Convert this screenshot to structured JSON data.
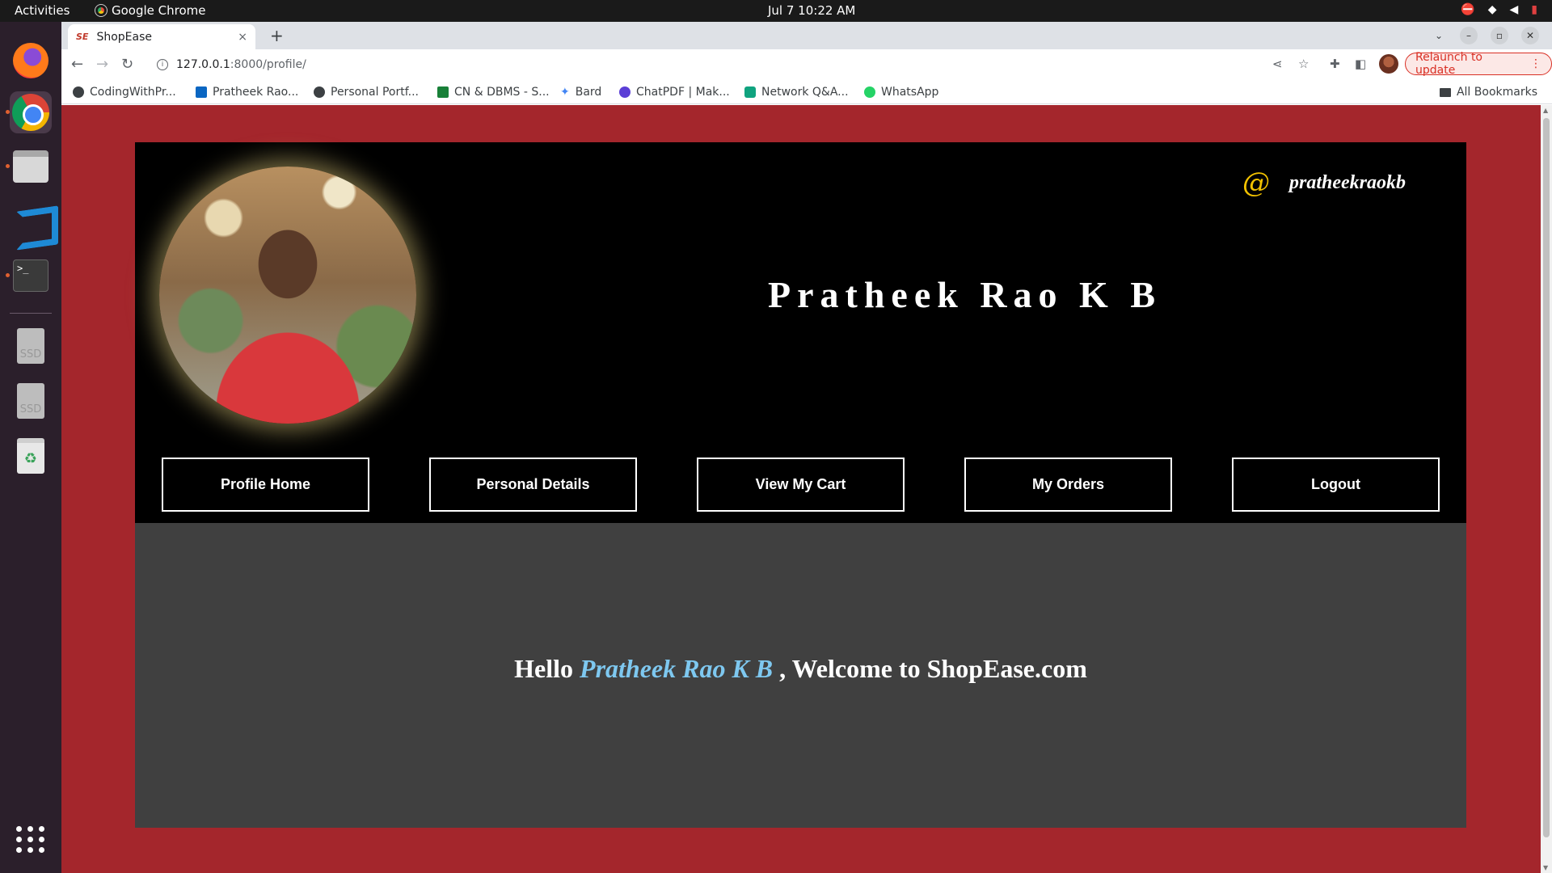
{
  "os": {
    "activities": "Activities",
    "active_app": "Google Chrome",
    "clock": "Jul 7  10:22 AM",
    "dock": {
      "ssd1": "SSD",
      "ssd2": "SSD",
      "terminal_prompt": ">_"
    }
  },
  "browser": {
    "tab": {
      "favicon": "SE",
      "title": "ShopEase",
      "close": "×"
    },
    "new_tab": "+",
    "url": {
      "host": "127.0.0.1",
      "path": ":8000/profile/"
    },
    "relaunch_label": "Relaunch to update",
    "bookmarks": [
      {
        "label": "CodingWithPr...",
        "color": "#3c4043"
      },
      {
        "label": "Pratheek Rao...",
        "color": "#0a66c2"
      },
      {
        "label": "Personal Portf...",
        "color": "#3c4043"
      },
      {
        "label": "CN & DBMS - S...",
        "color": "#188038"
      },
      {
        "label": "Bard",
        "color": "#4285f4"
      },
      {
        "label": "ChatPDF | Mak...",
        "color": "#5b3fd6"
      },
      {
        "label": "Network Q&A...",
        "color": "#10a37f"
      },
      {
        "label": "WhatsApp",
        "color": "#25d366"
      }
    ],
    "all_bookmarks": "All Bookmarks"
  },
  "page": {
    "background_color": "#a4262c",
    "profile": {
      "at_symbol": "@",
      "username": "pratheekraokb",
      "full_name": "Pratheek Rao K B"
    },
    "nav": [
      {
        "label": "Profile Home"
      },
      {
        "label": "Personal Details"
      },
      {
        "label": "View My Cart"
      },
      {
        "label": "My Orders"
      },
      {
        "label": "Logout"
      }
    ],
    "welcome": {
      "prefix": "Hello ",
      "name": "Pratheek Rao K B",
      "suffix": " , Welcome to ShopEase.com"
    }
  }
}
